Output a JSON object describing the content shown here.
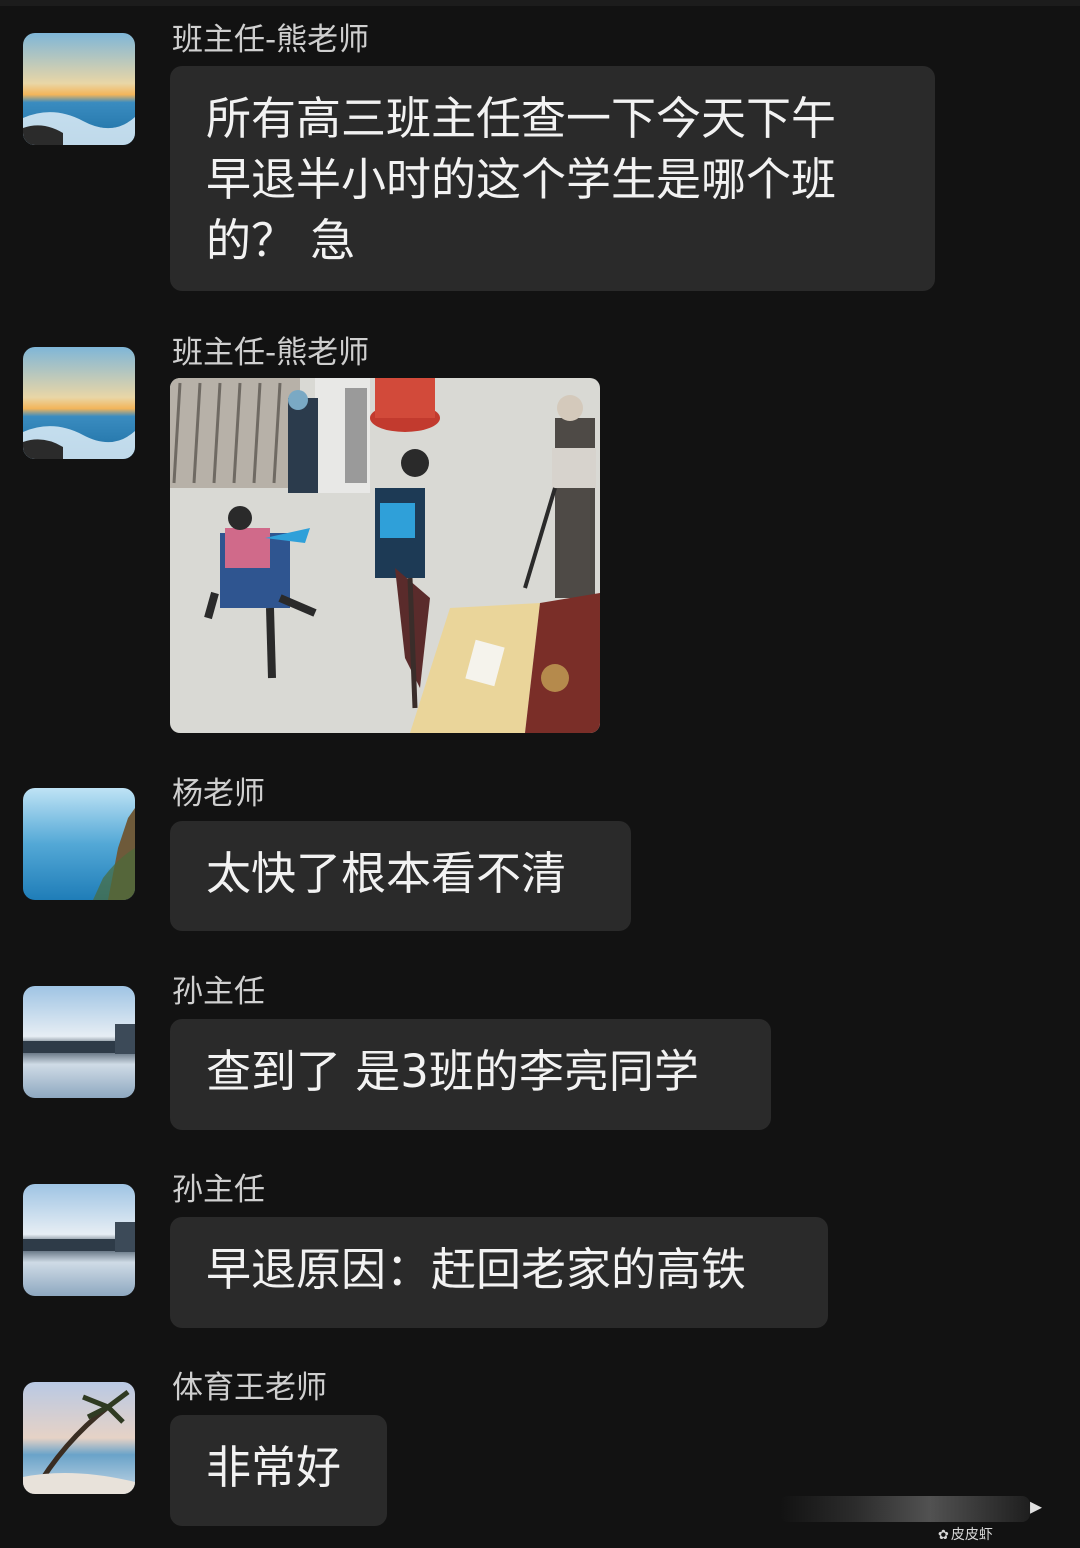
{
  "messages": [
    {
      "sender": "班主任-熊老师",
      "lines": [
        "所有高三班主任查一下今天下午",
        "早退半小时的这个学生是哪个班",
        "的？ 急"
      ],
      "avatar_icon": "sea-sunset-avatar"
    },
    {
      "sender": "班主任-熊老师",
      "image": "surveillance-photo",
      "avatar_icon": "sea-sunset-avatar"
    },
    {
      "sender": "杨老师",
      "lines": [
        "太快了根本看不清"
      ],
      "avatar_icon": "blue-sea-cliff-avatar"
    },
    {
      "sender": "孙主任",
      "lines": [
        "查到了 是3班的李亮同学"
      ],
      "avatar_icon": "lake-city-avatar"
    },
    {
      "sender": "孙主任",
      "lines": [
        "早退原因：赶回老家的高铁"
      ],
      "avatar_icon": "lake-city-avatar"
    },
    {
      "sender": "体育王老师",
      "lines": [
        "非常好"
      ],
      "avatar_icon": "palm-beach-avatar"
    }
  ],
  "watermark": {
    "text": "皮皮虾"
  },
  "colors": {
    "background": "#121212",
    "bubble": "#2a2a2a",
    "text": "#f2f2f2",
    "sender": "#cfcfcf"
  }
}
